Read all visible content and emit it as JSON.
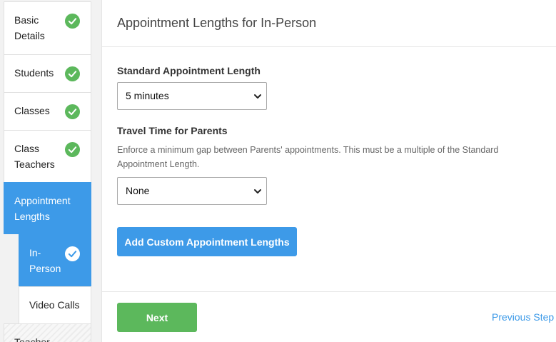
{
  "sidebar": {
    "items": [
      {
        "label": "Basic Details",
        "completed": true,
        "active": false
      },
      {
        "label": "Students",
        "completed": true,
        "active": false
      },
      {
        "label": "Classes",
        "completed": true,
        "active": false
      },
      {
        "label": "Class Teachers",
        "completed": true,
        "active": false
      },
      {
        "label": "Appointment Lengths",
        "completed": false,
        "active": true
      },
      {
        "label": "Teacher",
        "completed": false,
        "active": false,
        "disabled": true
      }
    ],
    "subitems": [
      {
        "label": "In-Person",
        "completed": true,
        "active": true
      },
      {
        "label": "Video Calls",
        "completed": false,
        "active": false
      }
    ]
  },
  "main": {
    "title": "Appointment Lengths for In-Person",
    "standard_length": {
      "label": "Standard Appointment Length",
      "value": "5 minutes"
    },
    "travel_time": {
      "label": "Travel Time for Parents",
      "help": "Enforce a minimum gap between Parents' appointments. This must be a multiple of the Standard Appointment Length.",
      "value": "None"
    },
    "custom_button_label": "Add Custom Appointment Lengths"
  },
  "footer": {
    "next_label": "Next",
    "previous_label": "Previous Step"
  },
  "colors": {
    "accent_blue": "#3d9ae8",
    "success_green": "#5cb85c"
  },
  "icons": {
    "completed": "check-circle-icon",
    "dropdown": "chevron-down-icon"
  }
}
